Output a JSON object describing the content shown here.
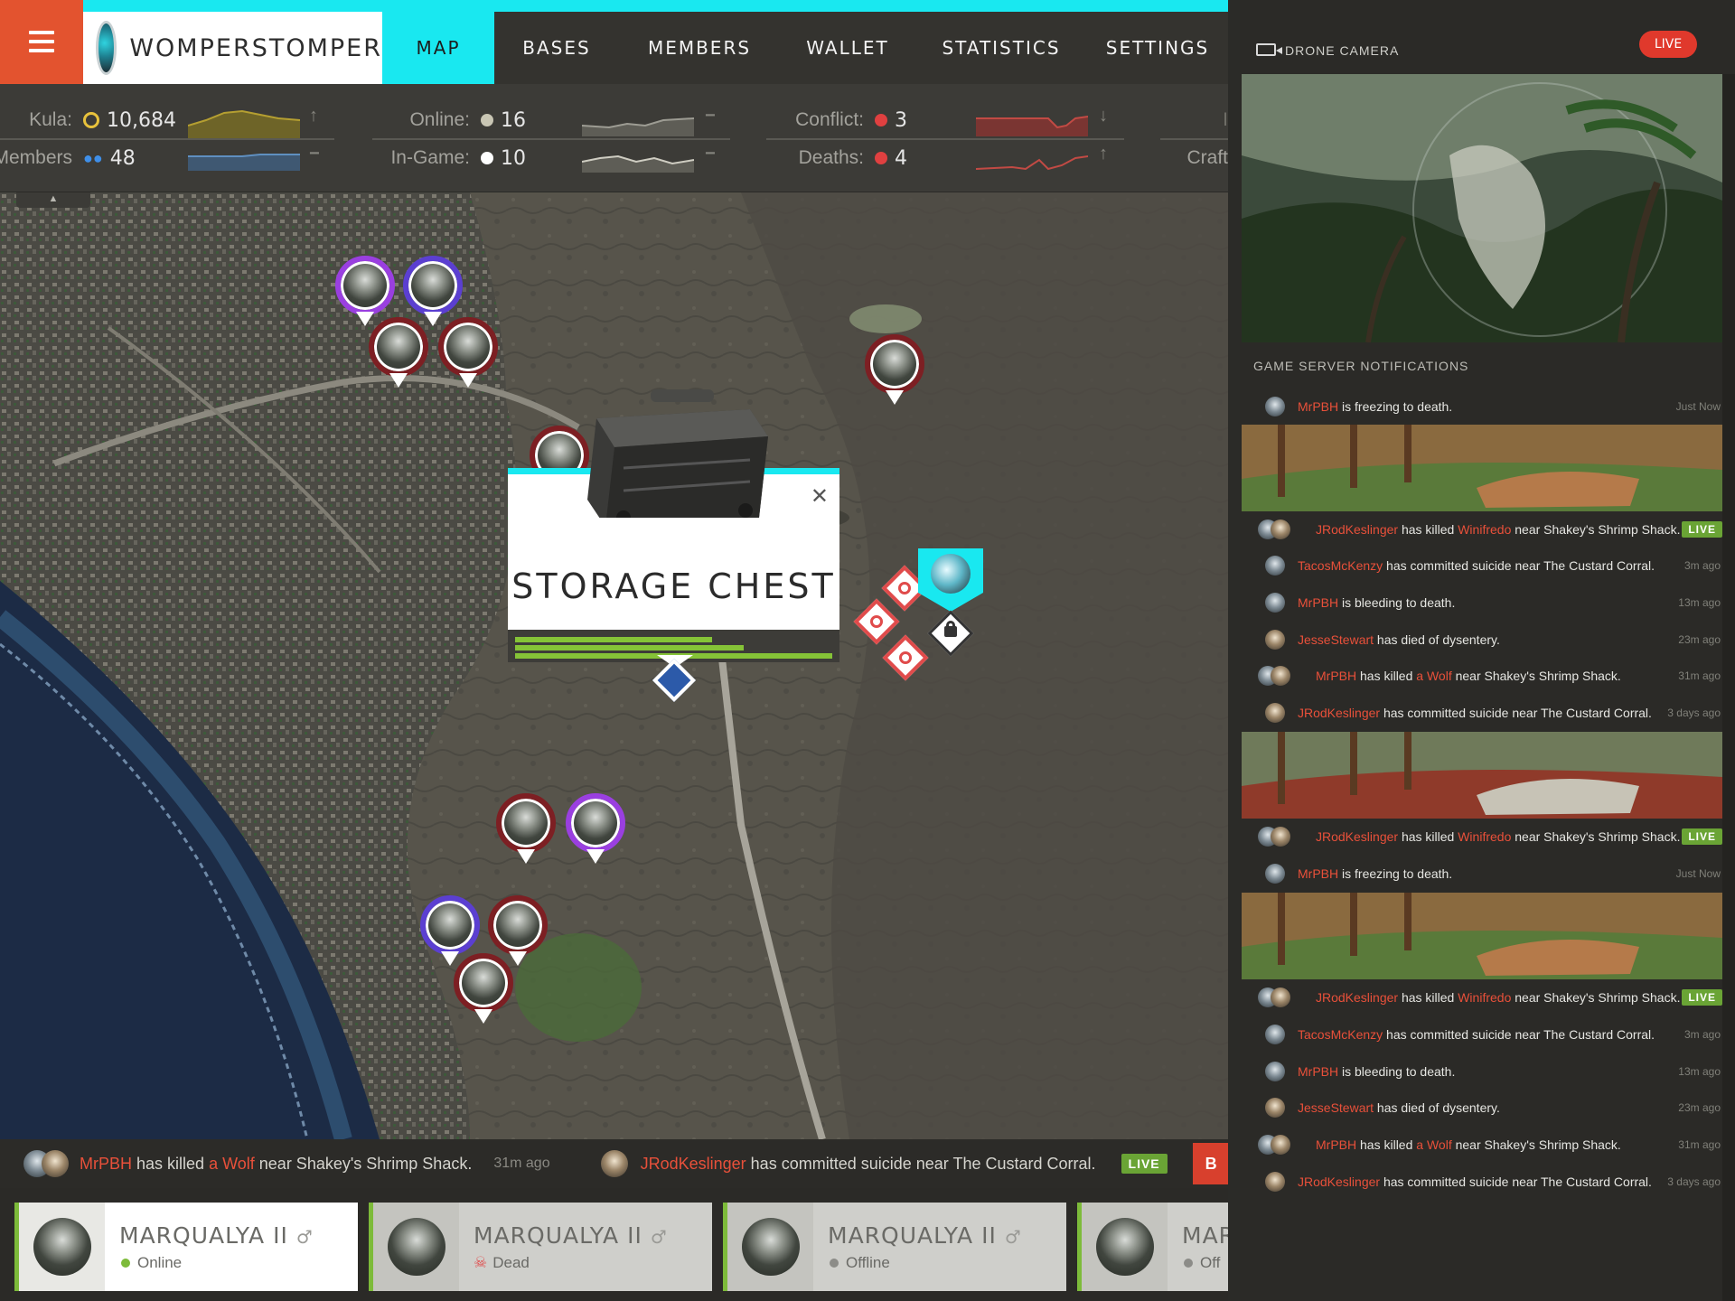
{
  "brand": {
    "name": "WOMPERSTOMPER"
  },
  "nav": {
    "tabs": [
      "MAP",
      "BASES",
      "MEMBERS",
      "WALLET",
      "STATISTICS",
      "SETTINGS"
    ],
    "active": "MAP"
  },
  "stats": {
    "kula": {
      "label": "Kula:",
      "value": "10,684"
    },
    "members": {
      "label": "Members:",
      "value": "48"
    },
    "online": {
      "label": "Online:",
      "value": "16"
    },
    "ingame": {
      "label": "In-Game:",
      "value": "10"
    },
    "conflict": {
      "label": "Conflict:",
      "value": "3"
    },
    "deaths": {
      "label": "Deaths:",
      "value": "4"
    },
    "craft": {
      "label": "Craft"
    }
  },
  "popup": {
    "title": "STORAGE CHEST",
    "progress": [
      0.62,
      0.72,
      1.0
    ]
  },
  "ticker": {
    "item1": {
      "actor": "MrPBH",
      "verb": "has killed",
      "target": "a Wolf",
      "rest": "near Shakey's Shrimp Shack.",
      "time": "31m ago"
    },
    "item2": {
      "actor": "JRodKeslinger",
      "rest": "has committed suicide near The Custard Corral.",
      "live": "LIVE",
      "extra": "B"
    }
  },
  "cards": [
    {
      "name": "MARQUALYA II",
      "gender": "♂",
      "status": "Online",
      "status_color": "#7dbb3a"
    },
    {
      "name": "MARQUALYA II",
      "gender": "♂",
      "status": "Dead",
      "status_color": "#e04b4b"
    },
    {
      "name": "MARQUALYA II",
      "gender": "♂",
      "status": "Offline",
      "status_color": "#8c8c88"
    },
    {
      "name": "MAR",
      "gender": "",
      "status": "Off",
      "status_color": "#8c8c88"
    }
  ],
  "sidebar": {
    "drone_title": "DRONE CAMERA",
    "live": "LIVE",
    "notif_title": "GAME SERVER NOTIFICATIONS",
    "notifications": [
      {
        "actor": "MrPBH",
        "text": " is freezing to death.",
        "time": "Just Now"
      },
      {
        "actor": "JRodKeslinger",
        "text": " has killed ",
        "target": "Winifredo",
        "text2": " near Shakey's Shrimp Shack.",
        "live": "LIVE"
      },
      {
        "actor": "TacosMcKenzy",
        "text": " has committed suicide near The Custard Corral.",
        "time": "3m ago"
      },
      {
        "actor": "MrPBH",
        "text": " is bleeding to death.",
        "time": "13m ago"
      },
      {
        "actor": "JesseStewart",
        "text": " has died of dysentery.",
        "time": "23m ago"
      },
      {
        "actor": "MrPBH",
        "text": " has killed ",
        "target": "a Wolf",
        "text2": " near Shakey's Shrimp Shack.",
        "time": "31m ago"
      },
      {
        "actor": "JRodKeslinger",
        "text": " has committed suicide near The Custard Corral.",
        "time": "3 days ago"
      },
      {
        "actor": "JRodKeslinger",
        "text": " has killed ",
        "target": "Winifredo",
        "text2": " near Shakey's Shrimp Shack.",
        "live": "LIVE"
      },
      {
        "actor": "MrPBH",
        "text": " is freezing to death.",
        "time": "Just Now"
      },
      {
        "actor": "JRodKeslinger",
        "text": " has killed ",
        "target": "Winifredo",
        "text2": " near Shakey's Shrimp Shack.",
        "live": "LIVE"
      },
      {
        "actor": "TacosMcKenzy",
        "text": " has committed suicide near The Custard Corral.",
        "time": "3m ago"
      },
      {
        "actor": "MrPBH",
        "text": " is bleeding to death.",
        "time": "13m ago"
      },
      {
        "actor": "JesseStewart",
        "text": " has died of dysentery.",
        "time": "23m ago"
      },
      {
        "actor": "MrPBH",
        "text": " has killed ",
        "target": "a Wolf",
        "text2": " near Shakey's Shrimp Shack.",
        "time": "31m ago"
      },
      {
        "actor": "JRodKeslinger",
        "text": " has committed suicide near The Custard Corral.",
        "time": "3 days ago"
      }
    ]
  },
  "colors": {
    "accent": "#19e8f0",
    "menu": "#e3532f",
    "alert": "#e8503a",
    "live": "#6aa435"
  }
}
